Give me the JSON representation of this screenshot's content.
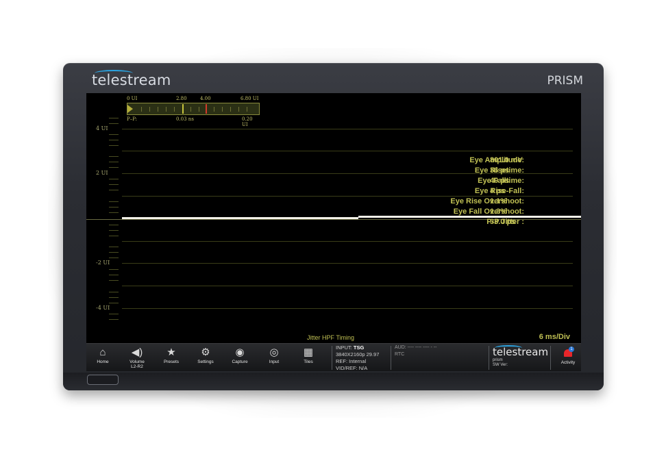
{
  "device": {
    "brand": "telestream",
    "model": "PRISM"
  },
  "meter": {
    "scale": [
      "0 UI",
      "2.80",
      "4.00",
      "6.80 UI"
    ],
    "pp_label": "P–P:",
    "pp_value": "0.03 ns",
    "max_label": "0.20 UI"
  },
  "plot": {
    "y_labels": [
      "4 UI",
      "2 UI",
      "-2 UI",
      "-4 UI"
    ],
    "measurements": [
      {
        "label": "Eye Amplitude:",
        "value": "801.0 mV"
      },
      {
        "label": "Eye Risetime:",
        "value": "36 ps"
      },
      {
        "label": "Eye Falltime:",
        "value": "40 ps"
      },
      {
        "label": "Eye Rise-Fall:",
        "value": "4 ps"
      },
      {
        "label": "Eye Rise Overshoot:",
        "value": "1.1%"
      },
      {
        "label": "Eye Fall Overshoot:",
        "value": "1.3%"
      },
      {
        "label": "P-P Jitter :",
        "value": "33.0 ps"
      }
    ],
    "title": "Jitter HPF Timing",
    "timebase": "6 ms/Div"
  },
  "taskbar": {
    "buttons": [
      {
        "label": "Home",
        "sub": "",
        "icon": "home-icon"
      },
      {
        "label": "Volume",
        "sub": "L2-R2",
        "icon": "speaker-icon"
      },
      {
        "label": "Presets",
        "sub": "",
        "icon": "star-icon"
      },
      {
        "label": "Settings",
        "sub": "",
        "icon": "gear-icon"
      },
      {
        "label": "Capture",
        "sub": "",
        "icon": "camera-icon"
      },
      {
        "label": "Input",
        "sub": "",
        "icon": "input-icon"
      },
      {
        "label": "Tiles",
        "sub": "",
        "icon": "tiles-icon"
      }
    ],
    "status": {
      "input_label": "INPUT:",
      "input_value": "TSG",
      "format": "3840X2160p 29.97",
      "ref": "REF: Internal",
      "vidref": "VID/REF: N/A"
    },
    "aud": "AUD: ---- ---- ---- - --",
    "rtc": "RTC",
    "brand": "telestream",
    "brand_sub": "prism",
    "sw_ver": "SW Ver:",
    "activity_label": "Activity",
    "activity_count": "1"
  }
}
